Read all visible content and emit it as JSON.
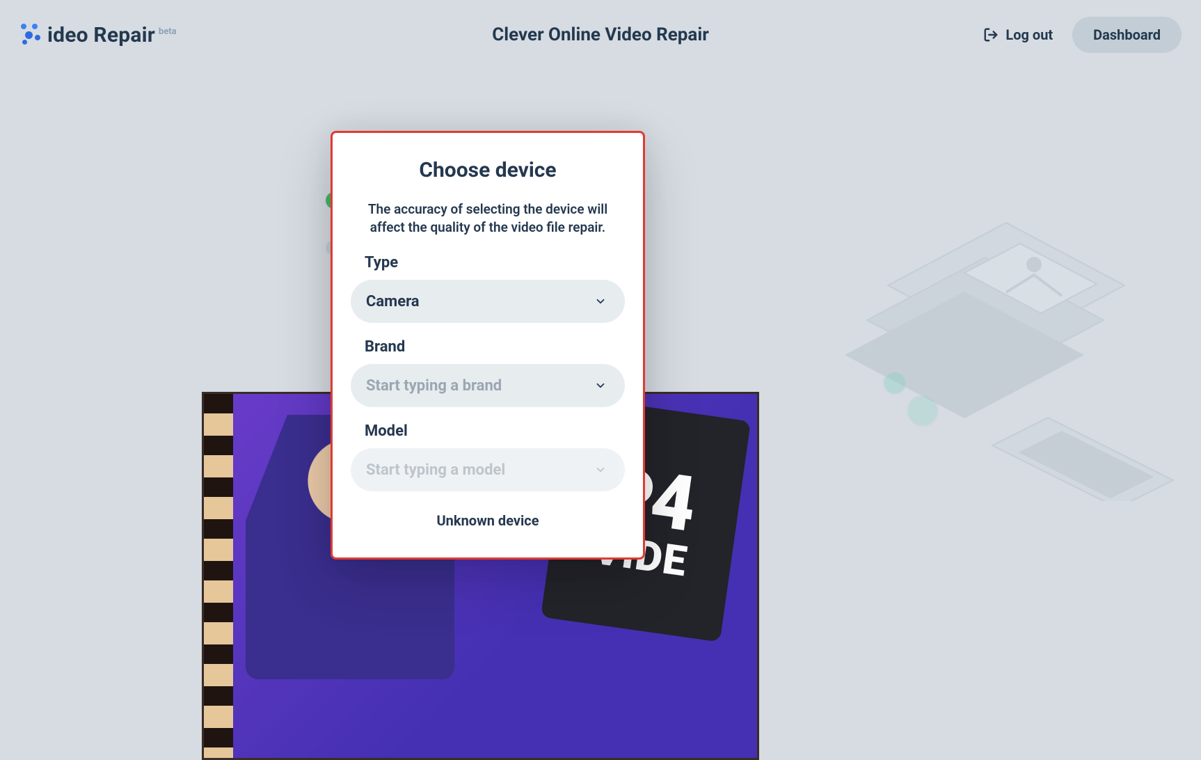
{
  "header": {
    "logo_text": "ideo Repair",
    "logo_beta": "beta",
    "title": "Clever Online Video Repair",
    "logout_label": "Log out",
    "dashboard_label": "Dashboard"
  },
  "modal": {
    "title": "Choose device",
    "subtitle": "The accuracy of selecting the device will affect the quality of the video file repair.",
    "type_label": "Type",
    "type_value": "Camera",
    "brand_label": "Brand",
    "brand_placeholder": "Start typing a brand",
    "model_label": "Model",
    "model_placeholder": "Start typing a model",
    "unknown_link": "Unknown device"
  },
  "thumb": {
    "p4": "P4",
    "video": "VIDE"
  }
}
